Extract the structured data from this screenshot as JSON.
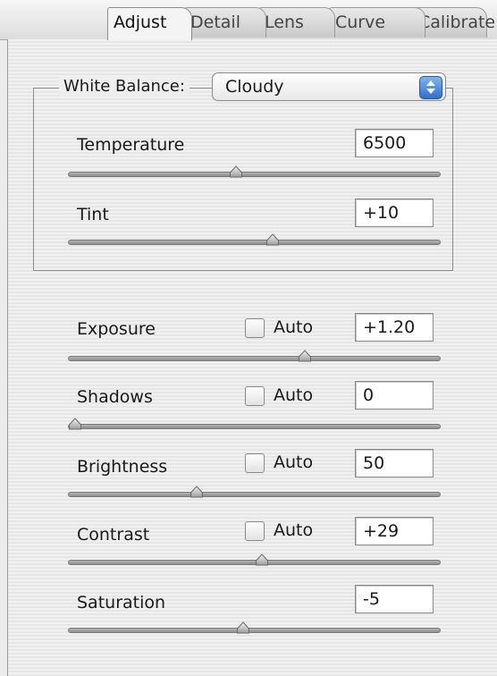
{
  "tabs": [
    "Adjust",
    "Detail",
    "Lens",
    "Curve",
    "Calibrate"
  ],
  "active_tab": "Adjust",
  "white_balance": {
    "label": "White Balance:",
    "value": "Cloudy"
  },
  "temperature": {
    "label": "Temperature",
    "value": "6500",
    "slider_fraction": 0.45
  },
  "tint": {
    "label": "Tint",
    "value": "+10",
    "slider_fraction": 0.55
  },
  "auto_label": "Auto",
  "exposure": {
    "label": "Exposure",
    "value": "+1.20",
    "auto": false,
    "slider_fraction": 0.64
  },
  "shadows": {
    "label": "Shadows",
    "value": "0",
    "auto": false,
    "slider_fraction": 0.0
  },
  "brightness": {
    "label": "Brightness",
    "value": "50",
    "auto": false,
    "slider_fraction": 0.34
  },
  "contrast": {
    "label": "Contrast",
    "value": "+29",
    "auto": false,
    "slider_fraction": 0.52
  },
  "saturation": {
    "label": "Saturation",
    "value": "-5",
    "slider_fraction": 0.47
  }
}
